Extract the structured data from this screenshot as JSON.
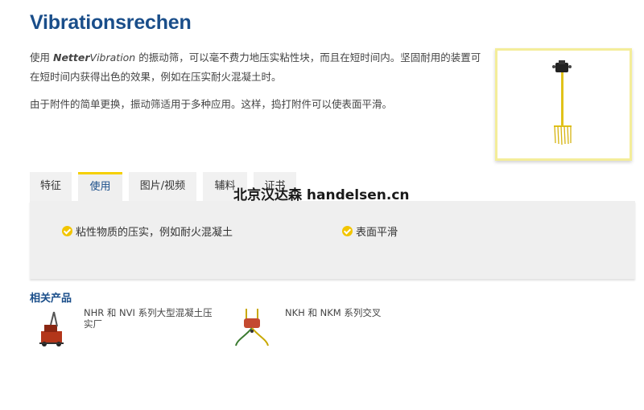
{
  "page": {
    "title": "Vibrationsrechen",
    "intro_p1_pre": "使用 ",
    "intro_p1_brand_bold": "Netter",
    "intro_p1_brand_italic": "Vibration",
    "intro_p1_post": " 的振动筛，可以毫不费力地压实粘性块，而且在短时间内。坚固耐用的装置可在短时间内获得出色的效果，例如在压实耐火混凝土时。",
    "intro_p2": "由于附件的简单更换，振动筛适用于多种应用。这样，捣打附件可以使表面平滑。"
  },
  "tabs": [
    {
      "label": "特征"
    },
    {
      "label": "使用"
    },
    {
      "label": "图片/视频"
    },
    {
      "label": "辅料"
    },
    {
      "label": "证书"
    }
  ],
  "active_tab": "使用",
  "usage": [
    {
      "text": "粘性物质的压实，例如耐火混凝土"
    },
    {
      "text": "表面平滑"
    }
  ],
  "watermark": "北京汉达森 handelsen.cn",
  "related": {
    "title": "相关产品",
    "items": [
      {
        "label": "NHR 和 NVI 系列大型混凝土压实厂"
      },
      {
        "label": "NKH 和 NKM 系列交叉"
      }
    ]
  },
  "colors": {
    "heading_blue": "#1a4e8a",
    "accent_yellow": "#f5d000",
    "check_yellow": "#f2c500",
    "frame_yellow": "#f4ed9a",
    "panel_gray": "#efefef"
  }
}
